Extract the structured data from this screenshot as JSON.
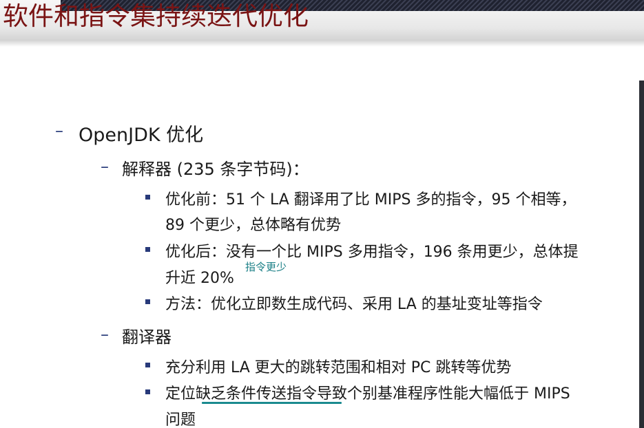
{
  "slide": {
    "title": "软件和指令集持续迭代优化",
    "items": {
      "openjdk": "OpenJDK 优化",
      "interpreter": "解释器 (235 条字节码)：",
      "interp_before_1": "优化前：51 个 LA 翻译用了比 MIPS 多的指令，95 个相等，",
      "interp_before_2": "89 个更少，总体略有优势",
      "interp_after_1": "优化后：没有一个比 MIPS 多用指令，196 条用更少，总体提",
      "interp_after_2": "升近 20%",
      "interp_method": "方法：优化立即数生成代码、采用 LA 的基址变址等指令",
      "translator": "翻译器",
      "trans_1": "充分利用 LA 更大的跳转范围和相对 PC 跳转等优势",
      "trans_2_prefix": "定位",
      "trans_2_marked": "缺乏条件传送指令",
      "trans_2_suffix": "导致个别基准程序性能大幅低于 MIPS",
      "trans_2_line2": "问题"
    },
    "annotation": "指令更少",
    "colors": {
      "title": "#7a1414",
      "bullet": "#283a7a",
      "annotation": "#1a7f86"
    }
  }
}
